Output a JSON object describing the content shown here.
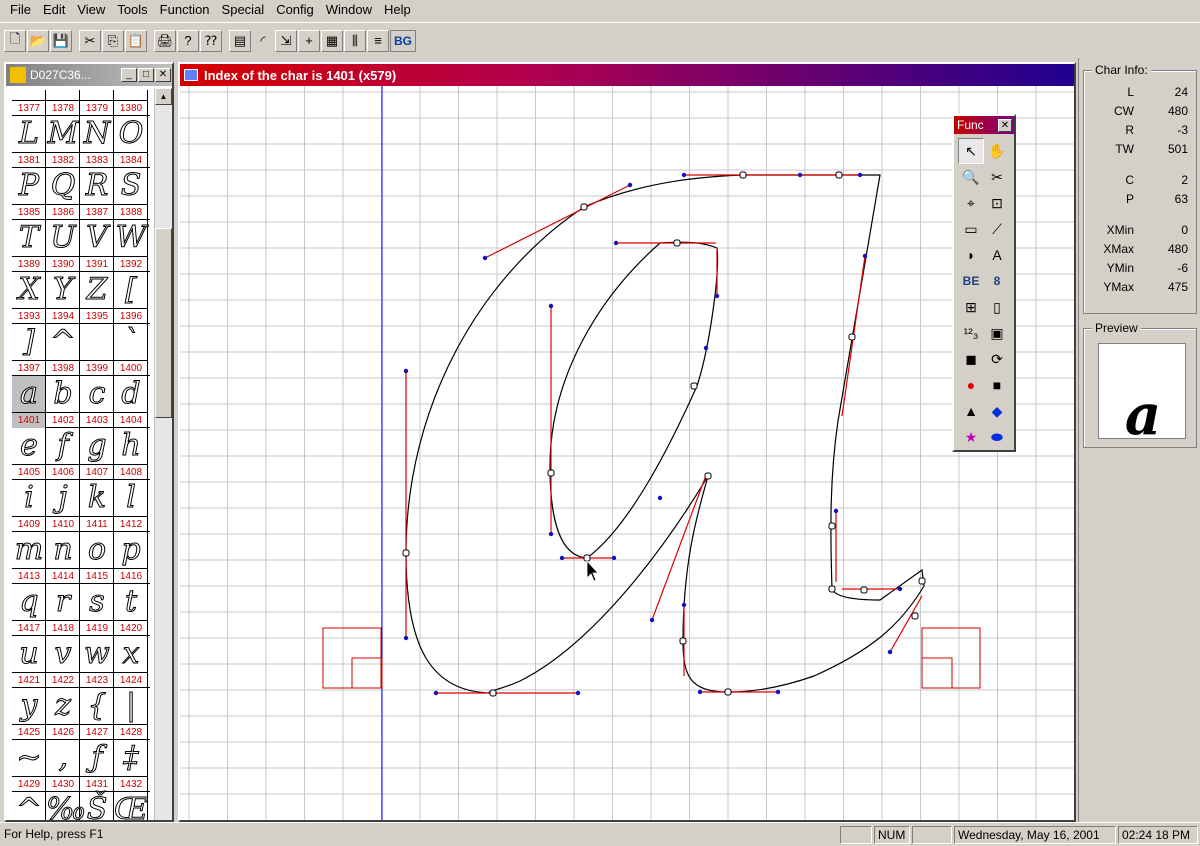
{
  "menu": [
    {
      "label": "File",
      "u": "F",
      "rest": "ile"
    },
    {
      "label": "Edit",
      "u": "E",
      "rest": "dit"
    },
    {
      "label": "View",
      "u": "V",
      "rest": "iew"
    },
    {
      "label": "Tools",
      "u": "T",
      "rest": "ools"
    },
    {
      "label": "Function",
      "u": "u",
      "pre": "F",
      "rest": "nction"
    },
    {
      "label": "Special",
      "u": "S",
      "rest": "pecial"
    },
    {
      "label": "Config",
      "u": "C",
      "rest": "onfig"
    },
    {
      "label": "Window",
      "u": "W",
      "rest": "indow"
    },
    {
      "label": "Help",
      "u": "H",
      "rest": "elp"
    }
  ],
  "toolbar": {
    "buttons": [
      "new-icon",
      "open-icon",
      "save-icon",
      "sep",
      "cut-icon",
      "copy-icon",
      "paste-icon",
      "sep",
      "print-icon",
      "help-icon",
      "context-help-icon",
      "sep",
      "properties-icon",
      "curve-icon",
      "transform-icon",
      "crosshair-icon",
      "grid-icon",
      "columns-icon",
      "lines-icon"
    ],
    "bg_label": "BG"
  },
  "glyph_window": {
    "title": "D027C36...",
    "rows": [
      {
        "chars": [
          "",
          "",
          "",
          ""
        ],
        "nums": [
          "1377",
          "1378",
          "1379",
          "1380"
        ]
      },
      {
        "chars": [
          "L",
          "M",
          "N",
          "O"
        ],
        "nums": [
          "1381",
          "1382",
          "1383",
          "1384"
        ]
      },
      {
        "chars": [
          "P",
          "Q",
          "R",
          "S"
        ],
        "nums": [
          "1385",
          "1386",
          "1387",
          "1388"
        ]
      },
      {
        "chars": [
          "T",
          "U",
          "V",
          "W"
        ],
        "nums": [
          "1389",
          "1390",
          "1391",
          "1392"
        ]
      },
      {
        "chars": [
          "X",
          "Y",
          "Z",
          "["
        ],
        "nums": [
          "1393",
          "1394",
          "1395",
          "1396"
        ]
      },
      {
        "chars": [
          "]",
          "^",
          "",
          "`"
        ],
        "nums": [
          "1397",
          "1398",
          "1399",
          "1400"
        ]
      },
      {
        "chars": [
          "a",
          "b",
          "c",
          "d"
        ],
        "nums": [
          "1401",
          "1402",
          "1403",
          "1404"
        ]
      },
      {
        "chars": [
          "e",
          "f",
          "g",
          "h"
        ],
        "nums": [
          "1405",
          "1406",
          "1407",
          "1408"
        ]
      },
      {
        "chars": [
          "i",
          "j",
          "k",
          "l"
        ],
        "nums": [
          "1409",
          "1410",
          "1411",
          "1412"
        ]
      },
      {
        "chars": [
          "m",
          "n",
          "o",
          "p"
        ],
        "nums": [
          "1413",
          "1414",
          "1415",
          "1416"
        ]
      },
      {
        "chars": [
          "q",
          "r",
          "s",
          "t"
        ],
        "nums": [
          "1417",
          "1418",
          "1419",
          "1420"
        ]
      },
      {
        "chars": [
          "u",
          "v",
          "w",
          "x"
        ],
        "nums": [
          "1421",
          "1422",
          "1423",
          "1424"
        ]
      },
      {
        "chars": [
          "y",
          "z",
          "{",
          "|"
        ],
        "nums": [
          "1425",
          "1426",
          "1427",
          "1428"
        ]
      },
      {
        "chars": [
          "~",
          "‚",
          "ƒ",
          "‡"
        ],
        "nums": [
          "1429",
          "1430",
          "1431",
          "1432"
        ]
      },
      {
        "chars": [
          "^",
          "‰",
          "Š",
          "Œ"
        ],
        "nums": [
          "",
          "",
          "",
          ""
        ]
      }
    ]
  },
  "editor": {
    "title": "Index of the char is 1401 (x579)"
  },
  "func_palette": {
    "title": "Func",
    "tools": [
      "pointer-icon",
      "hand-icon",
      "zoom-icon",
      "cut-point-icon",
      "add-point-icon",
      "transform-box-icon",
      "ruler-icon",
      "knife-icon",
      "half-circle-icon",
      "font-outline-icon",
      "BE",
      "8",
      "add-glyph-icon",
      "rect-outline-icon",
      "numbers-icon",
      "layers-icon",
      "square-fill-icon",
      "rotate-icon",
      "red-circle-icon",
      "black-square-icon",
      "black-triangle-icon",
      "blue-diamond-icon",
      "magenta-star-icon",
      "blue-ellipse-icon"
    ]
  },
  "char_info": {
    "label": "Char Info:",
    "rows1": [
      [
        "L",
        "24"
      ],
      [
        "CW",
        "480"
      ],
      [
        "R",
        "-3"
      ],
      [
        "TW",
        "501"
      ]
    ],
    "rows2": [
      [
        "C",
        "2"
      ],
      [
        "P",
        "63"
      ]
    ],
    "rows3": [
      [
        "XMin",
        "0"
      ],
      [
        "XMax",
        "480"
      ],
      [
        "YMin",
        "-6"
      ],
      [
        "YMax",
        "475"
      ]
    ]
  },
  "preview": {
    "label": "Preview",
    "glyph": "a"
  },
  "status": {
    "help": "For Help, press F1",
    "num": "NUM",
    "date": "Wednesday, May 16, 2001",
    "time": "02:24 18 PM"
  },
  "colors": {
    "accent_red": "#d00000",
    "outline": "#000000",
    "handle": "#ff0000",
    "point": "#0000cc",
    "baseline": "#0000ff"
  }
}
